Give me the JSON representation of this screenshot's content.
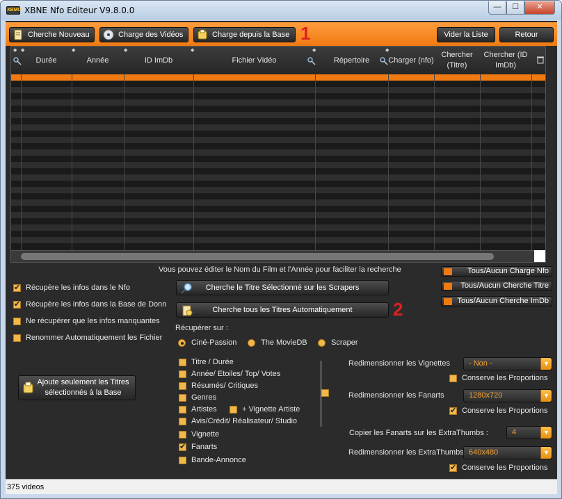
{
  "window": {
    "title": "XBNE Nfo Editeur V9.8.0.0",
    "app_icon_text": "XBMC",
    "min_glyph": "—",
    "max_glyph": "☐",
    "close_glyph": "✕"
  },
  "toolbar": {
    "cherche_nouveau": "Cherche Nouveau",
    "charge_videos": "Charge des Vidéos",
    "charge_base": "Charge depuis la Base",
    "vider_liste": "Vider la Liste",
    "retour": "Retour",
    "marker": "1"
  },
  "grid": {
    "columns": [
      "Durée",
      "Année",
      "ID ImDb",
      "Fichier Vidéo",
      "Répertoire",
      "Charger (nfo)",
      "Chercher (Titre)",
      "Chercher (ID ImDb)"
    ],
    "sort_glyph": "◆",
    "delete_glyph": "🗑",
    "rows": 28
  },
  "panel": {
    "info": "Vous pouvez éditer le Nom du Film et l'Année pour faciliter la recherche",
    "options": [
      {
        "label": "Récupère les infos dans le Nfo",
        "checked": true
      },
      {
        "label": "Récupère les infos dans la Base de Donn",
        "checked": true
      },
      {
        "label": "Ne récupérer que les infos manquantes",
        "checked": false
      },
      {
        "label": "Renommer Automatiquement les Fichier",
        "checked": false
      }
    ],
    "ajoute_btn_line1": "Ajoute seulement les Titres",
    "ajoute_btn_line2": "sélectionnés à la Base",
    "cherche_titre_btn": "Cherche le Titre Sélectionné sur les Scrapers",
    "cherche_tous_btn": "Cherche tous les Titres Automatiquement",
    "marker2": "2",
    "toggles": [
      "Tous/Aucun Charge Nfo",
      "Tous/Aucun Cherche Titre",
      "Tous/Aucun Cherche ImDb"
    ],
    "recuperer_label": "Récupérer sur :",
    "scrapers": [
      {
        "label": "Ciné-Passion",
        "selected": true
      },
      {
        "label": "The MovieDB",
        "selected": false
      },
      {
        "label": "Scraper",
        "selected": false
      }
    ],
    "fields": [
      {
        "label": "Titre / Durée",
        "checked": false
      },
      {
        "label": "Année/ Etoiles/ Top/ Votes",
        "checked": false
      },
      {
        "label": "Résumés/ Critiques",
        "checked": false
      },
      {
        "label": "Genres",
        "checked": false
      },
      {
        "label": "Artistes",
        "checked": false
      },
      {
        "label": "Avis/Crédit/ Réalisateur/ Studio",
        "checked": false
      },
      {
        "label": "Vignette",
        "checked": false
      },
      {
        "label": "Fanarts",
        "checked": true
      },
      {
        "label": "Bande-Annonce",
        "checked": false
      }
    ],
    "vignette_artiste": "+ Vignette Artiste",
    "redim_vignettes_label": "Redimensionner les Vignettes",
    "redim_vignettes_value": "- Non -",
    "conserve_1": "Conserve les Proportions",
    "conserve_1_checked": false,
    "redim_fanarts_label": "Redimensionner les Fanarts",
    "redim_fanarts_value": "1280x720",
    "conserve_2": "Conserve les Proportions",
    "conserve_2_checked": true,
    "copier_label": "Copier les Fanarts sur les ExtraThumbs :",
    "copier_value": "4",
    "redim_extra_label": "Redimensionner les ExtraThumbs",
    "redim_extra_value": "640x480",
    "conserve_3": "Conserve les Proportions",
    "conserve_3_checked": true,
    "combo_arrow": "▼"
  },
  "status": {
    "text": "375 videos"
  }
}
